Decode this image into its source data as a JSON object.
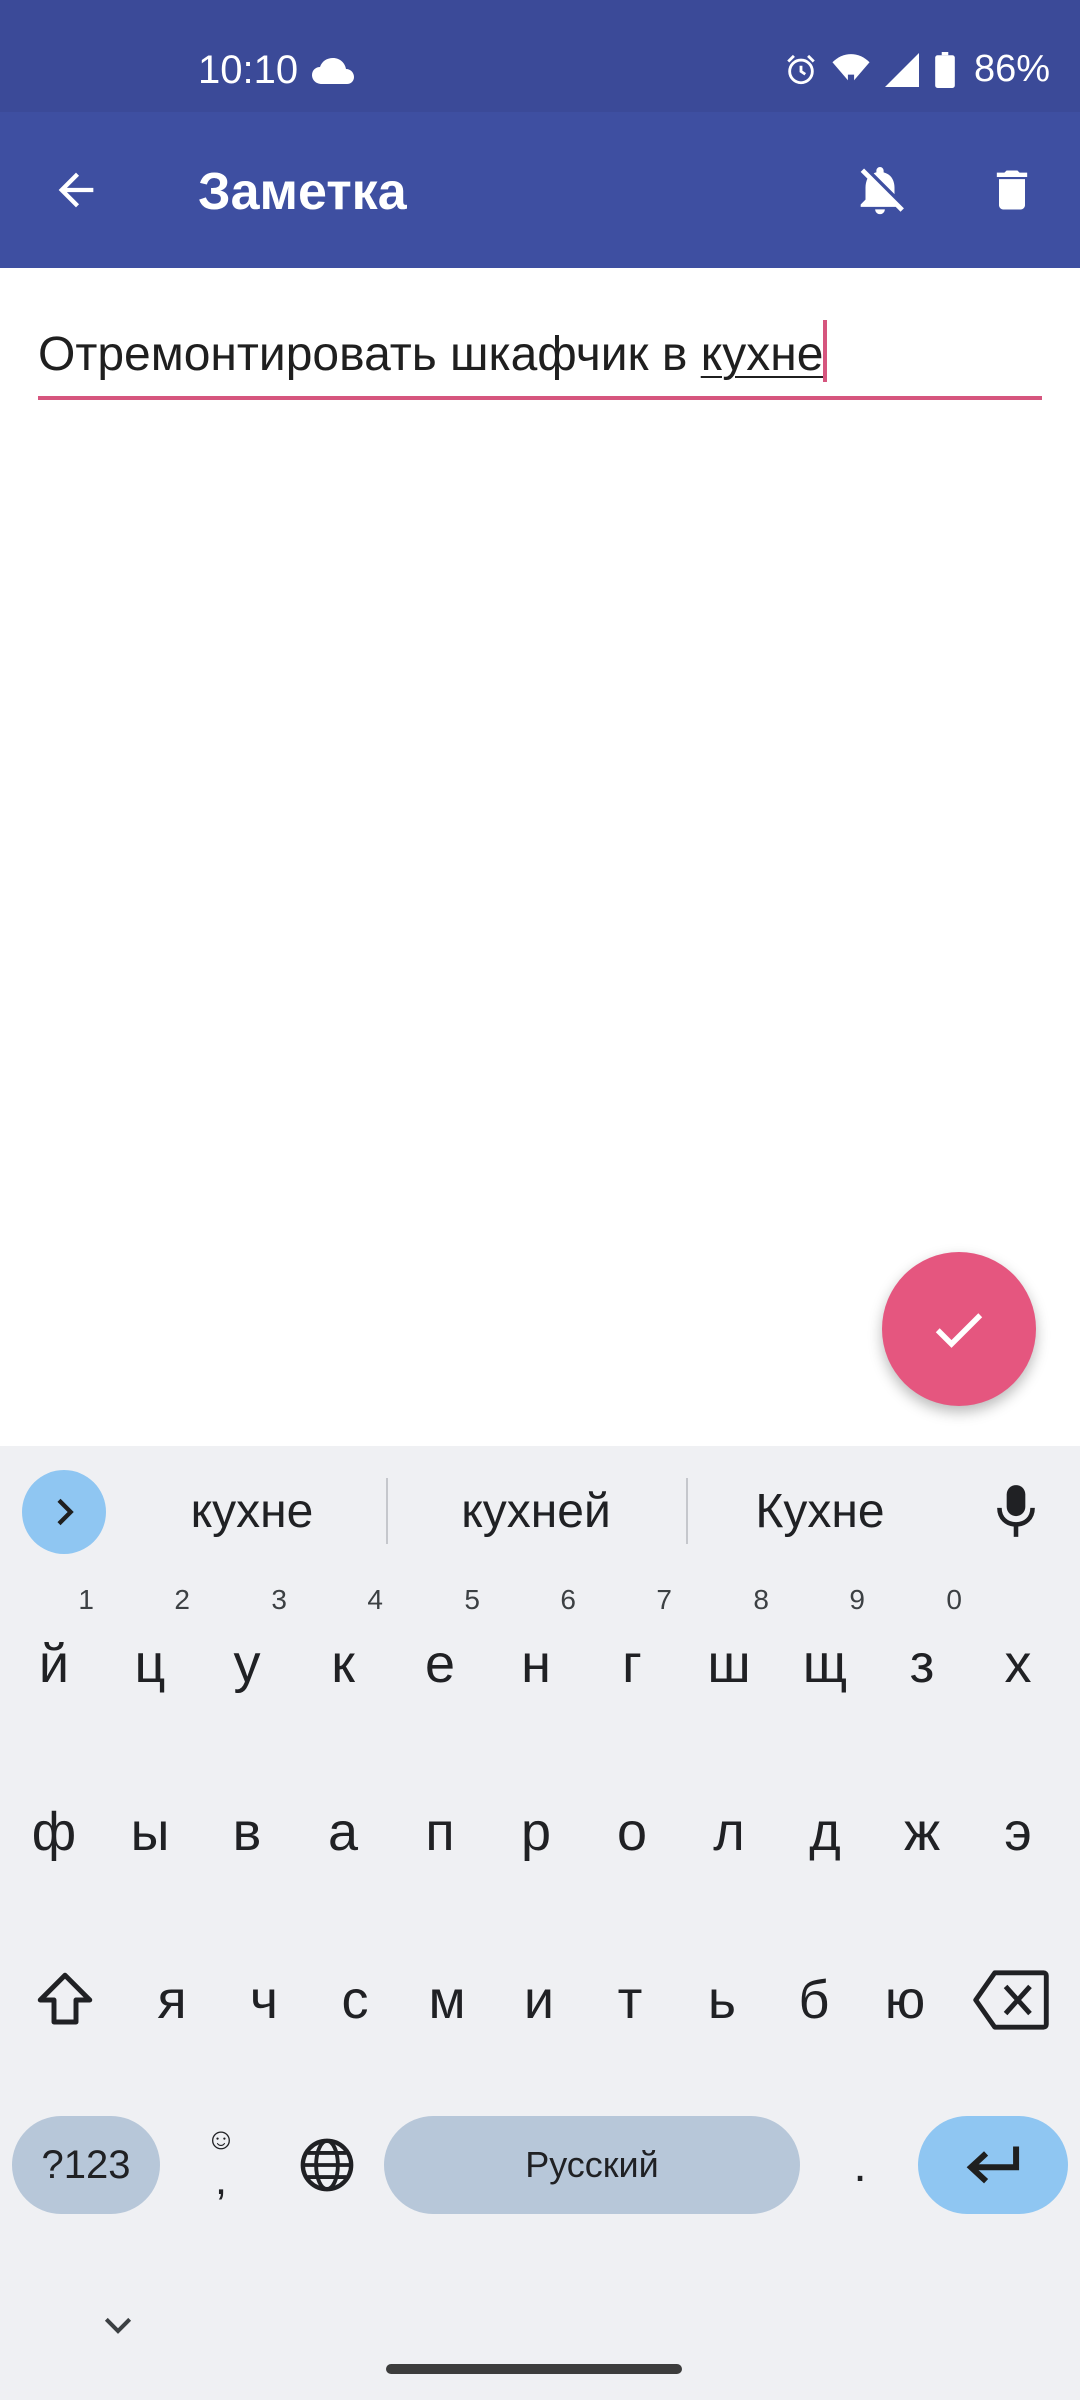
{
  "status_bar": {
    "time": "10:10",
    "battery_percent": "86%",
    "icons": [
      "cloud-icon",
      "alarm-icon",
      "wifi-icon",
      "signal-icon",
      "battery-icon"
    ]
  },
  "app_bar": {
    "title": "Заметка",
    "icons": [
      "arrow-back-icon",
      "bell-off-icon",
      "delete-icon"
    ]
  },
  "note": {
    "text_before": "Отремонтировать шкафчик в ",
    "composing_word": "кухне"
  },
  "fab": {
    "icon": "check-icon"
  },
  "keyboard": {
    "suggestions": [
      "кухне",
      "кухней",
      "Кухне"
    ],
    "row1": [
      {
        "k": "й",
        "h": "1"
      },
      {
        "k": "ц",
        "h": "2"
      },
      {
        "k": "у",
        "h": "3"
      },
      {
        "k": "к",
        "h": "4"
      },
      {
        "k": "е",
        "h": "5"
      },
      {
        "k": "н",
        "h": "6"
      },
      {
        "k": "г",
        "h": "7"
      },
      {
        "k": "ш",
        "h": "8"
      },
      {
        "k": "щ",
        "h": "9"
      },
      {
        "k": "з",
        "h": "0"
      },
      {
        "k": "х",
        "h": ""
      }
    ],
    "row2": [
      "ф",
      "ы",
      "в",
      "а",
      "п",
      "р",
      "о",
      "л",
      "д",
      "ж",
      "э"
    ],
    "row3": [
      "я",
      "ч",
      "с",
      "м",
      "и",
      "т",
      "ь",
      "б",
      "ю"
    ],
    "symbols_label": "?123",
    "emoji_glyph": "☺",
    "comma_label": ",",
    "space_label": "Русский",
    "period_label": ".",
    "colors": {
      "accent": "#8fc6f2",
      "key_pill": "#b7c7d9",
      "background": "#eff0f3"
    }
  },
  "colors": {
    "status_bar": "#3b4a98",
    "app_bar": "#3e4fa1",
    "accent": "#e5567f"
  }
}
